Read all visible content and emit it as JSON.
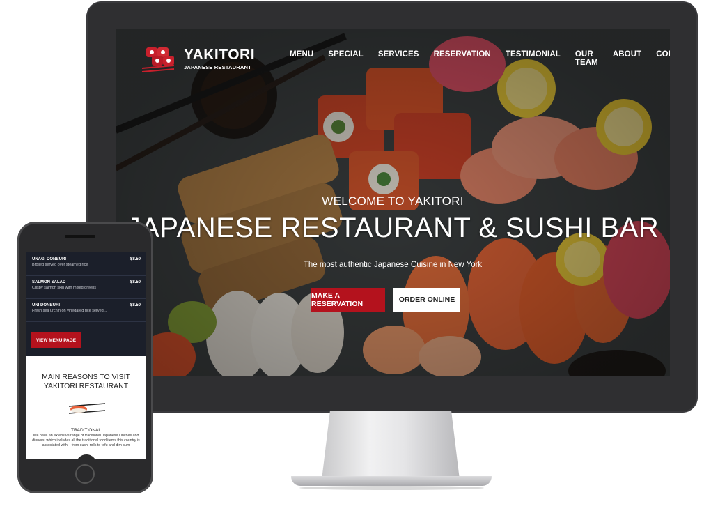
{
  "site": {
    "brand": "YAKITORI",
    "brand_sub": "JAPANESE RESTAURANT"
  },
  "nav": [
    "MENU",
    "SPECIAL",
    "SERVICES",
    "RESERVATION",
    "TESTIMONIAL",
    "OUR TEAM",
    "ABOUT",
    "CONTACTS"
  ],
  "hero": {
    "welcome": "WELCOME TO YAKITORI",
    "title": "JAPANESE RESTAURANT & SUSHI BAR",
    "subtitle": "The most authentic Japanese Cuisine in New York",
    "primary_button": "MAKE A RESERVATION",
    "secondary_button": "ORDER ONLINE"
  },
  "mobile": {
    "menu_items": [
      {
        "name": "UNAGI DONBURI",
        "desc": "Broiled served over steamed rice",
        "price": "$8.50"
      },
      {
        "name": "SALMON SALAD",
        "desc": "Crispy salmon skin with mixed greens",
        "price": "$8.50"
      },
      {
        "name": "UNI DONBURI",
        "desc": "Fresh sea urchin on vinegared rice served...",
        "price": "$8.50"
      }
    ],
    "menu_button": "VIEW MENU PAGE",
    "reasons_title": "MAIN REASONS TO VISIT YAKITORI RESTAURANT",
    "reason_label": "TRADITIONAL",
    "reason_text": "We have an extensive range of traditional Japanese lunches and dinners, which includes all the traditional food items this country is associated with – from sushi rolls to tofu and dim sum"
  },
  "colors": {
    "accent": "#b4121d",
    "dark_panel": "#1b1f2a",
    "bezel": "#2f2f31"
  }
}
